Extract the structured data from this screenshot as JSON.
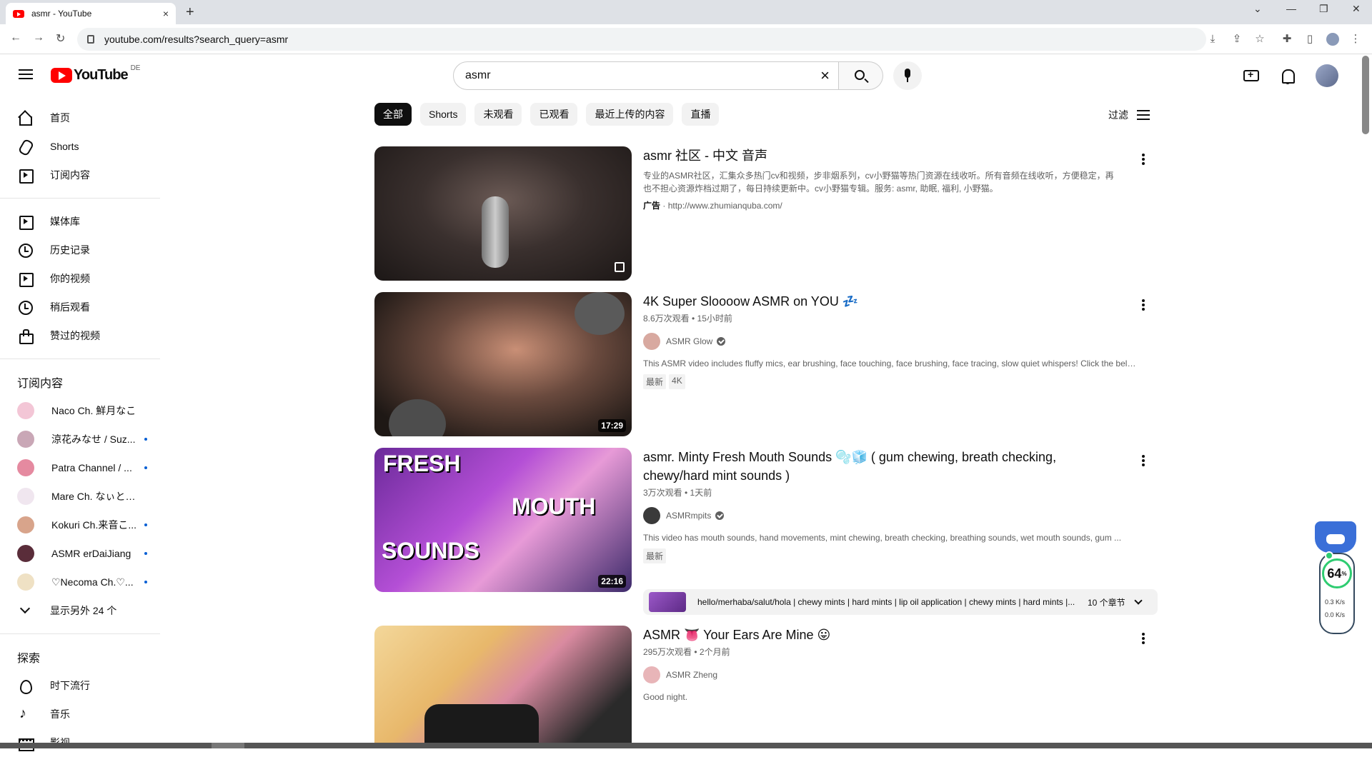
{
  "browser": {
    "tab_title": "asmr - YouTube",
    "new_tab_symbol": "+",
    "tab_close_symbol": "×",
    "url": "youtube.com/results?search_query=asmr",
    "window_controls": [
      "⌄",
      "—",
      "❐",
      "✕"
    ]
  },
  "header": {
    "logo_text": "YouTube",
    "country_code": "DE",
    "search_value": "asmr",
    "clear_symbol": "×"
  },
  "sidebar": {
    "main": [
      {
        "label": "首页",
        "icon": "home-icon"
      },
      {
        "label": "Shorts",
        "icon": "shorts-icon"
      },
      {
        "label": "订阅内容",
        "icon": "subscriptions-icon"
      }
    ],
    "library": [
      {
        "label": "媒体库",
        "icon": "library-icon"
      },
      {
        "label": "历史记录",
        "icon": "history-icon"
      },
      {
        "label": "你的视频",
        "icon": "your-videos-icon"
      },
      {
        "label": "稍后观看",
        "icon": "watch-later-icon"
      },
      {
        "label": "赞过的视频",
        "icon": "liked-videos-icon"
      }
    ],
    "subscriptions_heading": "订阅内容",
    "subscriptions": [
      {
        "name": "Naco Ch. 鮮月なこ",
        "new": false,
        "color": "#f3c6d6"
      },
      {
        "name": "涼花みなせ / Suz...",
        "new": true,
        "color": "#c9a7b6"
      },
      {
        "name": "Patra Channel / ...",
        "new": true,
        "color": "#e58aa0"
      },
      {
        "name": "Mare Ch. なぃとめ...",
        "new": false,
        "color": "#f0e6ef"
      },
      {
        "name": "Kokuri Ch.来音こ...",
        "new": true,
        "color": "#d8a48b"
      },
      {
        "name": "ASMR erDaiJiang",
        "new": true,
        "color": "#5a2d3a"
      },
      {
        "name": "♡Necoma Ch.♡...",
        "new": true,
        "color": "#efe1c4"
      }
    ],
    "show_more": "显示另外 24 个",
    "explore_heading": "探索",
    "explore": [
      {
        "label": "时下流行",
        "icon": "trending-icon"
      },
      {
        "label": "音乐",
        "icon": "music-icon"
      },
      {
        "label": "影视",
        "icon": "movies-icon"
      }
    ]
  },
  "chips": [
    "全部",
    "Shorts",
    "未观看",
    "已观看",
    "最近上传的内容",
    "直播"
  ],
  "filter_label": "过滤",
  "results": {
    "ad": {
      "title": "asmr 社区 - 中文 音声",
      "description": "专业的ASMR社区，汇集众多热门cv和视频，步非烟系列，cv小野猫等热门资源在线收听。所有音频在线收听，方便稳定，再也不担心资源炸档过期了，每日持续更新中。cv小野猫专辑。服务: asmr, 助眠, 福利, 小野猫。",
      "ad_label": "广告",
      "url": "http://www.zhumianquba.com/"
    },
    "videos": [
      {
        "title": "4K Super Sloooow ASMR on YOU 💤",
        "stats": "8.6万次观看 • 15小时前",
        "channel": "ASMR Glow",
        "desc": "This ASMR video includes fluffy mics, ear brushing, face touching, face brushing, face tracing, slow quiet whispers! Click the bell ...",
        "badges": [
          "最新",
          "4K"
        ],
        "duration": "17:29"
      },
      {
        "title": "asmr. Minty Fresh Mouth Sounds 🫧🧊 ( gum chewing, breath checking, chewy/hard mint sounds )",
        "stats": "3万次观看 • 1天前",
        "channel": "ASMRmpits",
        "desc": "This video has mouth sounds, hand movements, mint chewing, breath checking, breathing sounds, wet mouth sounds, gum ...",
        "badges": [
          "最新"
        ],
        "duration": "22:16",
        "chapters_text": "hello/merhaba/salut/hola | chewy mints | hard mints | lip oil application | chewy mints | hard mints |...",
        "chapters_count": "10 个章节",
        "thumb_text": [
          "FRESH",
          "MOUTH",
          "SOUNDS"
        ]
      },
      {
        "title": "ASMR 👅 Your Ears Are Mine 😛",
        "stats": "295万次观看 • 2个月前",
        "channel": "ASMR Zheng",
        "desc": "Good night."
      }
    ]
  },
  "widget": {
    "percent": "64",
    "percent_unit": "%",
    "up": "0.3 K/s",
    "down": "0.0 K/s"
  }
}
